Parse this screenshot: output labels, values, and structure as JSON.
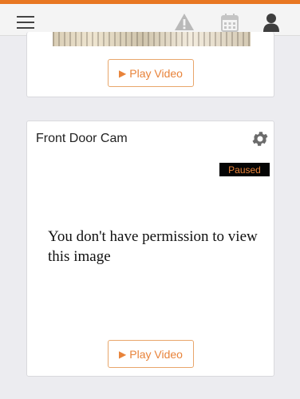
{
  "header": {
    "menu_icon": "hamburger-menu-icon",
    "alert_icon": "warning-triangle-icon",
    "calendar_icon": "calendar-icon",
    "user_icon": "user-icon",
    "accent_color": "#e87722"
  },
  "top_card": {
    "play_label": "Play Video",
    "play_icon": "play-icon"
  },
  "camera_card": {
    "name": "Front Door Cam",
    "settings_icon": "gear-icon",
    "status": "Paused",
    "message": "You don't have permission to view this image",
    "play_label": "Play Video",
    "play_icon": "play-icon"
  }
}
